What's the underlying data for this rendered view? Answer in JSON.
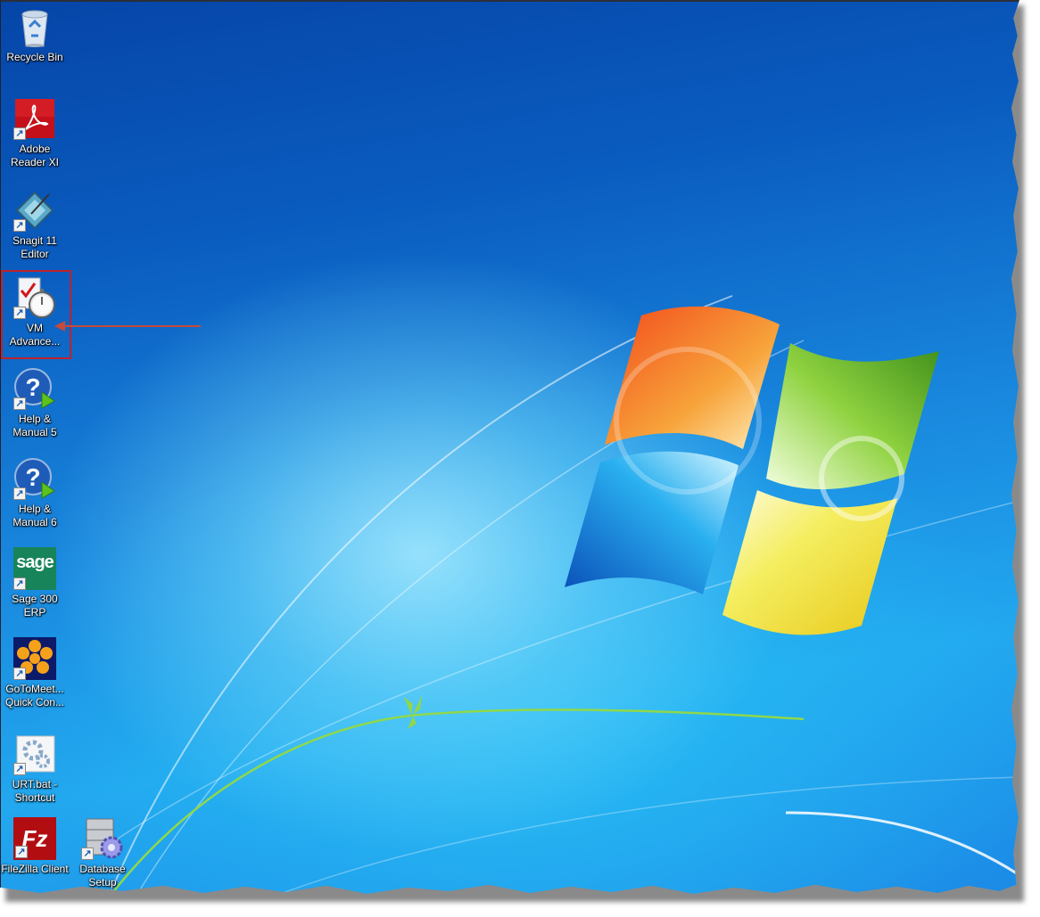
{
  "desktop": {
    "wallpaper": "windows-7-default",
    "colors": {
      "background_top": "#0645a8",
      "background_bottom": "#22a8ef",
      "annotation_red": "#c0222a",
      "arrow_red": "#c74a3a",
      "logo_orange": "#f05a1e",
      "logo_green": "#5aa820",
      "logo_blue": "#1668c8",
      "logo_yellow": "#f2d81e"
    },
    "icons": [
      {
        "label": "Recycle Bin",
        "icon": "recycle-bin-icon",
        "shortcut": false
      },
      {
        "label": "Adobe Reader XI",
        "icon": "adobe-reader-icon",
        "shortcut": true
      },
      {
        "label": "Snagit 11 Editor",
        "icon": "snagit-editor-icon",
        "shortcut": true
      },
      {
        "label": "VM Advance...",
        "icon": "vm-advance-stopwatch-icon",
        "shortcut": true,
        "highlighted": true
      },
      {
        "label": "Help & Manual 5",
        "icon": "help-manual-icon",
        "shortcut": true
      },
      {
        "label": "Help & Manual 6",
        "icon": "help-manual-icon",
        "shortcut": true
      },
      {
        "label": "Sage 300 ERP",
        "icon": "sage-icon",
        "shortcut": true,
        "glyph_text": "sage"
      },
      {
        "label": "GoToMeet... Quick Con...",
        "icon": "gotomeeting-icon",
        "shortcut": true
      },
      {
        "label": "URT.bat - Shortcut",
        "icon": "batch-file-gear-icon",
        "shortcut": true
      },
      {
        "label": "FileZilla Client",
        "icon": "filezilla-icon",
        "shortcut": true,
        "glyph_text": "Fz"
      },
      {
        "label": "Database Setup",
        "icon": "database-setup-icon",
        "shortcut": true
      }
    ],
    "annotation": {
      "type": "red-box-with-arrow",
      "target": "VM Advance..."
    }
  }
}
